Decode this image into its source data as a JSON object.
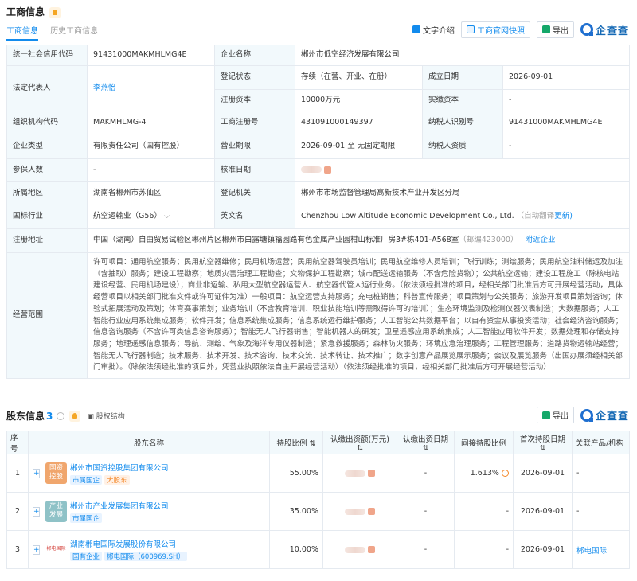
{
  "header": {
    "section_title": "工商信息",
    "tabs": [
      "工商信息",
      "历史工商信息"
    ],
    "tool_text_intro": "文字介绍",
    "tool_snapshot": "工商官网快照",
    "tool_export": "导出",
    "brand": "企查查"
  },
  "info": {
    "credit_code_label": "统一社会信用代码",
    "credit_code": "91431000MAKMHLMG4E",
    "company_name_label": "企业名称",
    "company_name": "郴州市低空经济发展有限公司",
    "legal_rep_label": "法定代表人",
    "legal_rep": "李燕怡",
    "status_label": "登记状态",
    "status": "存续（在营、开业、在册）",
    "est_date_label": "成立日期",
    "est_date": "2026-09-01",
    "reg_capital_label": "注册资本",
    "reg_capital": "10000万元",
    "paid_capital_label": "实缴资本",
    "paid_capital": "-",
    "org_code_label": "组织机构代码",
    "org_code": "MAKMHLMG-4",
    "reg_no_label": "工商注册号",
    "reg_no": "431091000149397",
    "taxpayer_id_label": "纳税人识别号",
    "taxpayer_id": "91431000MAKMHLMG4E",
    "company_type_label": "企业类型",
    "company_type": "有限责任公司（国有控股）",
    "term_label": "营业期限",
    "term": "2026-09-01 至 无固定期限",
    "taxpayer_qual_label": "纳税人资质",
    "taxpayer_qual": "-",
    "insured_label": "参保人数",
    "insured": "-",
    "approval_date_label": "核准日期",
    "region_label": "所属地区",
    "region": "湖南省郴州市苏仙区",
    "authority_label": "登记机关",
    "authority": "郴州市市场监督管理局高新技术产业开发区分局",
    "industry_label": "国标行业",
    "industry": "航空运输业（G56）",
    "english_name_label": "英文名",
    "english_name": "Chenzhou Low Altitude Economic Development Co., Ltd.",
    "auto_translate": "（自动翻译",
    "update_link": "更新)",
    "address_label": "注册地址",
    "address": "中国（湖南）自由贸易试验区郴州片区郴州市白露塘镇福园路有色金属产业园柑山标准厂房3#栋401-A568室",
    "postcode": "（邮编423000）",
    "nearby_link": "附近企业",
    "scope_label": "经营范围",
    "scope": "许可项目：通用航空服务；民用航空器维修；民用机场运营；民用航空器驾驶员培训；民用航空维修人员培训；飞行训练；测绘服务；民用航空油料储运及加注（含抽取）服务；建设工程勘察；地质灾害治理工程勘查；文物保护工程勘察；城市配送运输服务（不含危险货物）；公共航空运输；建设工程施工（除核电站建设经营、民用机场建设）；商业非运输、私用大型航空器运营人、航空器代管人运行业务。（依法须经批准的项目，经相关部门批准后方可开展经营活动，具体经营项目以相关部门批准文件或许可证件为准）一般项目：航空运营支持服务；充电桩销售；科普宣传服务；项目策划与公关服务；旅游开发项目策划咨询；体验式拓展活动及策划；体育赛事策划；业务培训（不含教育培训、职业技能培训等需取得许可的培训）；生态环境监测及检测仪器仪表制造；大数据服务；人工智能行业应用系统集成服务；软件开发；信息系统集成服务；信息系统运行维护服务；人工智能公共数据平台；以自有资金从事投资活动；社会经济咨询服务；信息咨询服务（不含许可类信息咨询服务）；智能无人飞行器销售；智能机器人的研发；卫星遥感应用系统集成；人工智能应用软件开发；数据处理和存储支持服务；地理遥感信息服务；导航、测绘、气象及海洋专用仪器制造；紧急救援服务；森林防火服务；环境应急治理服务；工程管理服务；道路货物运输站经营；智能无人飞行器制造；技术服务、技术开发、技术咨询、技术交流、技术转让、技术推广；数字创意产品展览展示服务；会议及展览服务（出国办展须经相关部门审批）。（除依法须经批准的项目外，凭营业执照依法自主开展经营活动）（依法须经批准的项目，经相关部门批准后方可开展经营活动）"
  },
  "shareholders": {
    "title": "股东信息",
    "count": "3",
    "equity_link": "股权结构",
    "export": "导出",
    "brand": "企查查",
    "columns": [
      "序号",
      "股东名称",
      "持股比例",
      "认缴出资额(万元)",
      "认缴出资日期",
      "间接持股比例",
      "首次持股日期",
      "关联产品/机构"
    ],
    "rows": [
      {
        "no": "1",
        "logo": "国资\n控股",
        "logo_color": "#f0a66d",
        "name": "郴州市国资控股集团有限公司",
        "tags": [
          "市属国企",
          "大股东"
        ],
        "ratio": "55.00%",
        "sub_date": "-",
        "indirect": "1.613%",
        "first_date": "2026-09-01",
        "related": "-"
      },
      {
        "no": "2",
        "logo": "产业\n发展",
        "logo_color": "#8fc2c7",
        "name": "郴州市产业发展集团有限公司",
        "tags": [
          "市属国企"
        ],
        "ratio": "35.00%",
        "sub_date": "-",
        "indirect": "-",
        "first_date": "2026-09-01",
        "related": "-"
      },
      {
        "no": "3",
        "logo": "郴电国际",
        "logo_color": "#d4403a",
        "name": "湖南郴电国际发展股份有限公司",
        "tags": [
          "国有企业",
          "郴电国际（600969.SH）"
        ],
        "ratio": "10.00%",
        "sub_date": "-",
        "indirect": "-",
        "first_date": "2026-09-01",
        "related": "郴电国际"
      }
    ]
  }
}
